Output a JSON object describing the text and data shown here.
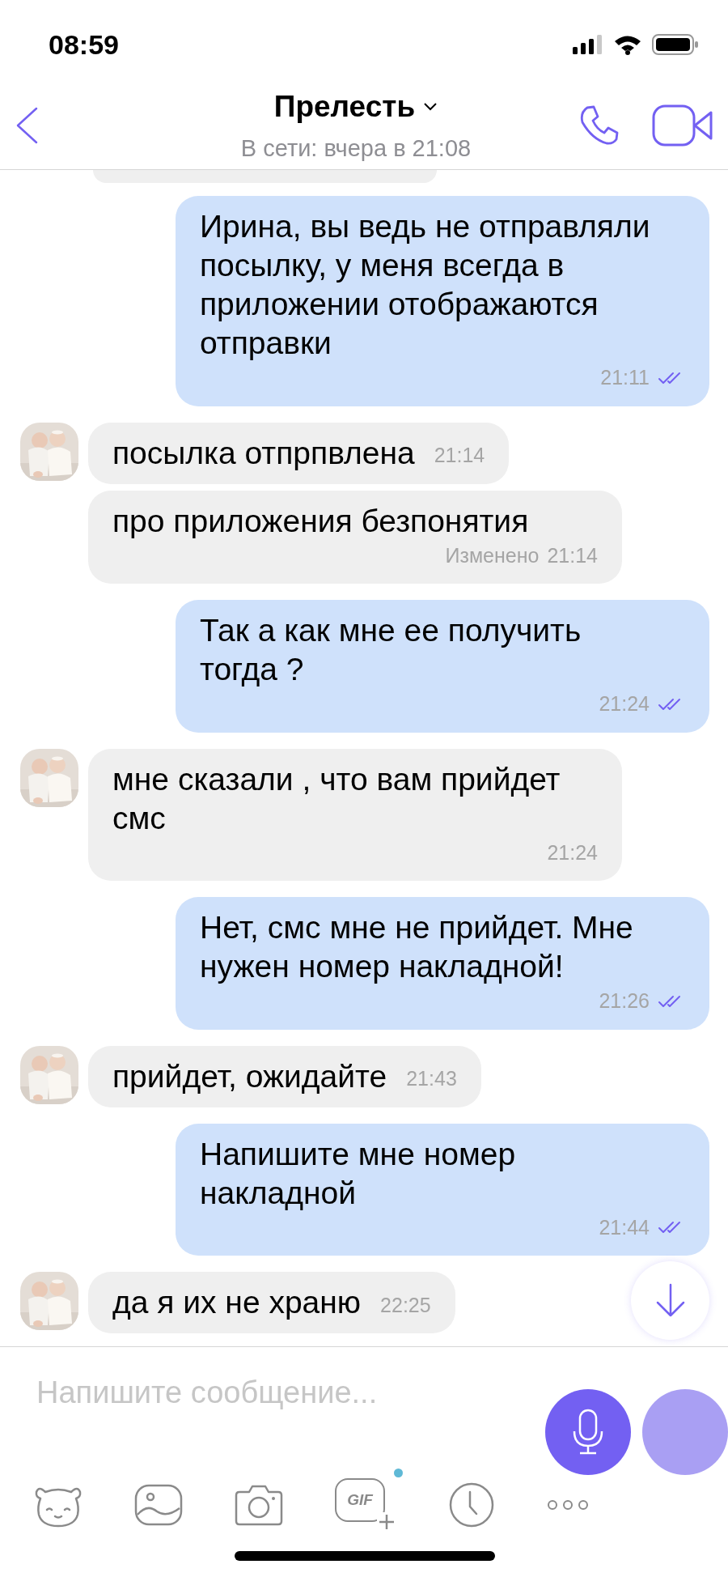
{
  "status_bar": {
    "time": "08:59"
  },
  "header": {
    "title": "Прелесть",
    "subtitle": "В сети: вчера в 21:08"
  },
  "messages": [
    {
      "outgoing": true,
      "text": "Ирина, вы ведь не отправляли посылку, у меня всегда в приложении отображаются отправки",
      "time": "21:11",
      "read": true
    },
    {
      "outgoing": false,
      "avatar": true,
      "text": "посылка отпрпвлена",
      "time": "21:14"
    },
    {
      "outgoing": false,
      "avatar": false,
      "text": "про приложения безпонятия",
      "time": "21:14",
      "edited_label": "Изменено"
    },
    {
      "outgoing": true,
      "text": "Так а как мне ее получить тогда ?",
      "time": "21:24",
      "read": true
    },
    {
      "outgoing": false,
      "avatar": true,
      "text": "мне сказали , что вам прийдет смс",
      "time": "21:24"
    },
    {
      "outgoing": true,
      "text": "Нет, смс мне не прийдет. Мне нужен номер накладной!",
      "time": "21:26",
      "read": true
    },
    {
      "outgoing": false,
      "avatar": true,
      "text": "прийдет, ожидайте",
      "time": "21:43"
    },
    {
      "outgoing": true,
      "text": "Напишите мне номер накладной",
      "time": "21:44",
      "read": true
    },
    {
      "outgoing": false,
      "avatar": true,
      "text": "да я их не храню",
      "time": "22:25"
    }
  ],
  "composer": {
    "placeholder": "Напишите сообщение..."
  },
  "toolbar": {
    "gif_label": "GIF",
    "gif_badge": true
  }
}
